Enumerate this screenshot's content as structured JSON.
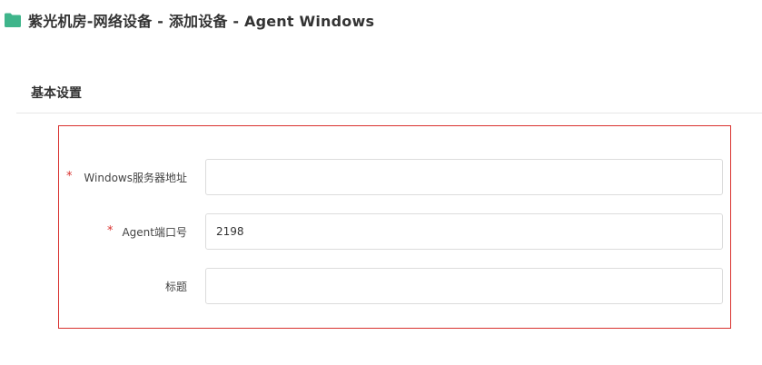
{
  "header": {
    "title": "紫光机房-网络设备 - 添加设备 - Agent Windows",
    "icon": "folder-icon",
    "icon_color": "#3fb58b"
  },
  "section": {
    "title": "基本设置"
  },
  "form": {
    "border_color": "#d9312e",
    "fields": [
      {
        "label": "Windows服务器地址",
        "required": true,
        "required_mark": "*",
        "value": ""
      },
      {
        "label": "Agent端口号",
        "required": true,
        "required_mark": "*",
        "value": "2198"
      },
      {
        "label": "标题",
        "required": false,
        "value": ""
      }
    ]
  }
}
